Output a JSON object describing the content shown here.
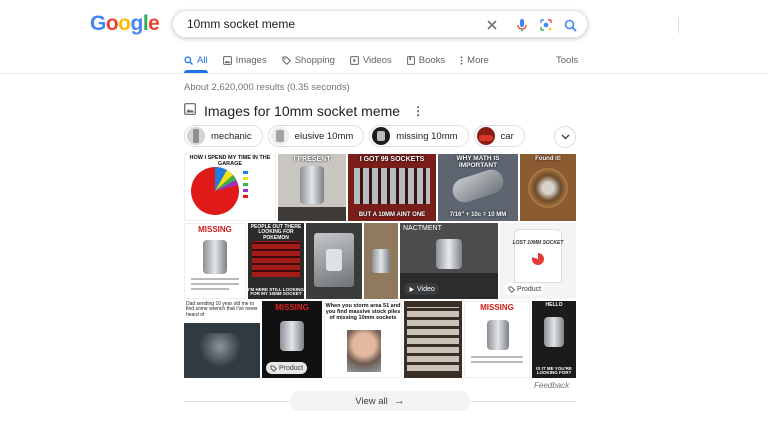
{
  "logo": {
    "letters": [
      "G",
      "o",
      "o",
      "g",
      "l",
      "e"
    ],
    "colors": [
      "#4285f4",
      "#ea4335",
      "#fbbc05",
      "#4285f4",
      "#34a853",
      "#ea4335"
    ]
  },
  "search": {
    "query": "10mm socket meme"
  },
  "tabs": [
    {
      "label": "All",
      "icon": "search-icon"
    },
    {
      "label": "Images",
      "icon": "image-icon"
    },
    {
      "label": "Shopping",
      "icon": "tag-icon"
    },
    {
      "label": "Videos",
      "icon": "play-icon"
    },
    {
      "label": "Books",
      "icon": "book-icon"
    },
    {
      "label": "More",
      "icon": "more-vert-icon"
    }
  ],
  "tools": "Tools",
  "results_count": "About 2,620,000 results (0.35 seconds)",
  "images_section": {
    "title": "Images for 10mm socket meme",
    "chips": [
      "mechanic",
      "elusive 10mm",
      "missing 10mm",
      "car"
    ],
    "captions": {
      "t1": "HOW I SPEND MY TIME IN THE GARAGE",
      "t2": "I PRESENT",
      "t3_top": "I GOT 99 SOCKETS",
      "t3_bottom": "BUT A 10MM AINT ONE",
      "t4_top": "WHY MATH IS IMPORTANT",
      "t4_bottom": "7/16\" + 10c = 10 MM",
      "t5": "Found it!",
      "t6": "MISSING",
      "t8_top": "PEOPLE OUT THERE LOOKING FOR POKEMON",
      "t8_bottom": "I'M HERE STILL LOOKING FOR MY 10MM SOCKET",
      "t10": "NACTMENT",
      "t11": "LOST 10MM SOCKET",
      "t12": "Dad sending 10 year old me to find some wrench that I've never heard of",
      "t13": "MISSING",
      "t14": "When you storm area 51 and you find massive stock piles of missing 10mm sockets",
      "t16": "MISSING",
      "t17_top": "HELLO",
      "t17_bottom": "IS IT ME YOU'RE LOOKING FOR?"
    },
    "badges": {
      "video": "Video",
      "product1": "Product",
      "product2": "Product"
    },
    "feedback": "Feedback",
    "view_all": "View all"
  }
}
